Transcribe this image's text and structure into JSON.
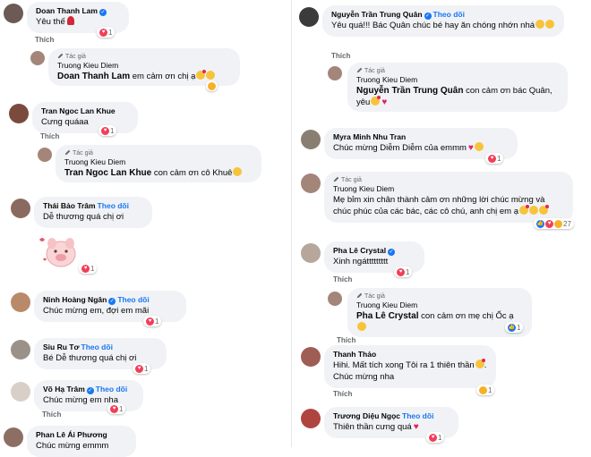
{
  "like_label": "Thích",
  "follow_label": "Theo dõi",
  "author_tag": "Tác giả",
  "left": [
    {
      "name": "Doan Thanh Lam",
      "verified": true,
      "text": "Yêu thế",
      "count": "1"
    },
    {
      "name": "Truong Kieu Diem",
      "ref": "Doan Thanh Lam",
      "text": "em cảm ơn chị ạ"
    },
    {
      "name": "Tran Ngoc Lan Khue",
      "text": "Cưng quáaa",
      "count": "1"
    },
    {
      "name": "Truong Kieu Diem",
      "ref": "Tran Ngoc Lan Khue",
      "text": "con cảm ơn cô Khuê"
    },
    {
      "name": "Thái Bảo Trâm",
      "follow": true,
      "text": "Dễ thương quá chị ơi",
      "sticker_count": "1"
    },
    {
      "name": "Ninh Hoàng Ngân",
      "verified": true,
      "follow": true,
      "text": "Chúc mừng em, đợi em mãi",
      "count": "1"
    },
    {
      "name": "Siu Ru Tơ",
      "follow": true,
      "text": "Bé Dễ thương quá chị ơi",
      "count": "1"
    },
    {
      "name": "Võ Hạ Trâm",
      "verified": true,
      "follow": true,
      "text": "Chúc mừng em nha",
      "count": "1"
    },
    {
      "name": "Phan Lê Ái Phương",
      "text": "Chúc mừng emmm"
    }
  ],
  "right": [
    {
      "name": "Nguyễn Trần Trung Quân",
      "verified": true,
      "follow": true,
      "text": "Yêu quá!!! Bác Quân chúc bé hay ăn chóng nhớn nhá",
      "count": "1"
    },
    {
      "name": "Truong Kieu Diem",
      "ref": "Nguyễn Trần Trung Quân",
      "text": "con cảm ơn bác Quân, yêu"
    },
    {
      "name": "Myra Minh Nhu Tran",
      "text": "Chúc mừng Diễm Diễm của emmm",
      "count": "1"
    },
    {
      "name": "Truong Kieu Diem",
      "text": "Mẹ bỉm xin chân thành cảm ơn những lời chúc mừng và chúc phúc của các bác, các cô chú, anh chị em ạ",
      "count": "27"
    },
    {
      "name": "Pha Lê Crystal",
      "verified": true,
      "text": "Xinh ngáttttttttt",
      "count": "1"
    },
    {
      "name": "Truong Kieu Diem",
      "ref": "Pha Lê Crystal",
      "text": "con cảm ơn mẹ chị Ốc ạ",
      "count": "1"
    },
    {
      "name": "Thanh Thảo",
      "text": "Hihi. Mất tích xong Tôi ra 1 thiên thần",
      "text2": "Chúc mừng nha",
      "count": "1"
    },
    {
      "name": "Trương Diệu Ngọc",
      "follow": true,
      "text": "Thiên thần cưng quá",
      "count": "1"
    }
  ]
}
